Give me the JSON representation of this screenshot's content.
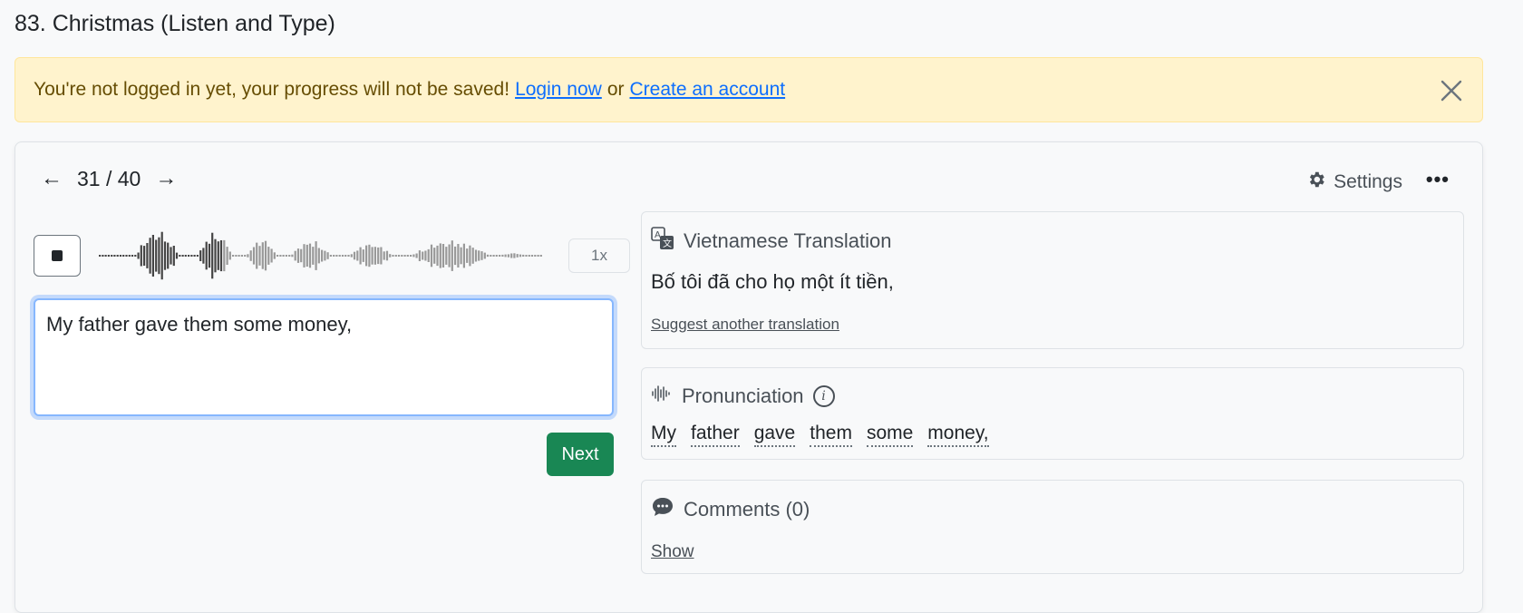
{
  "page": {
    "title": "83. Christmas (Listen and Type)"
  },
  "alert": {
    "message": "You're not logged in yet, your progress will not be saved!",
    "login_link": "Login now",
    "or_text": "or",
    "create_link": "Create an account",
    "close_icon": "close-icon",
    "background": "#fff3cd"
  },
  "nav": {
    "prev_icon": "←",
    "counter": "31 / 40",
    "next_icon": "→"
  },
  "toolbar": {
    "settings_label": "Settings",
    "more_icon": "•••"
  },
  "player": {
    "stop_icon": "stop-icon",
    "speed": "1x",
    "progress": 0.28
  },
  "answer": {
    "value": "My father gave them some money,"
  },
  "next_button": {
    "label": "Next",
    "color": "#198754"
  },
  "translation": {
    "title": "Vietnamese Translation",
    "icon": "translate-icon",
    "text": "Bố tôi đã cho họ một ít tiền,",
    "suggest_link": "Suggest another translation"
  },
  "pronunciation": {
    "title": "Pronunciation",
    "icon": "audio-wave-icon",
    "words": [
      "My",
      "father",
      "gave",
      "them",
      "some",
      "money,"
    ]
  },
  "comments": {
    "title": "Comments (0)",
    "icon": "chat-icon",
    "show_link": "Show"
  }
}
